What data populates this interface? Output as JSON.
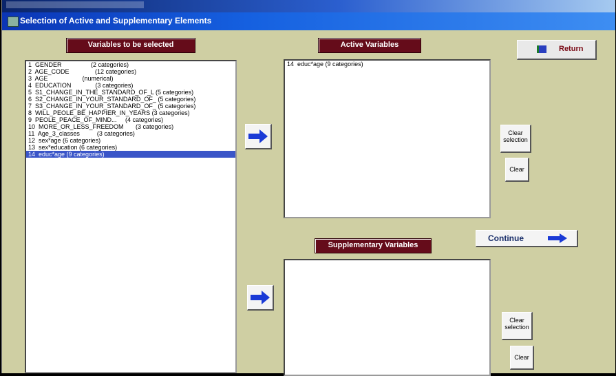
{
  "window": {
    "title": "Selection of Active and Supplementary Elements"
  },
  "headers": {
    "variables_to_select": "Variables to be selected",
    "active_variables": "Active Variables",
    "supplementary_variables": "Supplementary Variables"
  },
  "buttons": {
    "return": "Return",
    "continue": "Continue",
    "clear_selection": [
      "Clear",
      "selection"
    ],
    "clear": "Clear"
  },
  "variables": [
    "1  GENDER                 (2 categories)",
    "2  AGE_CODE               (12 categories)",
    "3  AGE                    (numerical)",
    "4  EDUCATION              (3 categories)",
    "5  S1_CHANGE_IN_THE_STANDARD_OF_L (5 categories)",
    "6  S2_CHANGE_IN_YOUR_STANDARD_OF_ (5 categories)",
    "7  S3_CHANGE_IN_YOUR_STANDARD_OF_ (5 categories)",
    "8  WILL_PEOLE_BE_HAPPIER_IN_YEARS (3 categories)",
    "9  PEOLE_PEACE_OF_MIND...     (4 categories)",
    "10  MORE_OR_LESS_FREEDOM       (3 categories)",
    "11  Age_3_classes          (3 categories)",
    "12  sex*age (6 categories)",
    "13  sex*education (6 categories)",
    "14  educ*age (9 categories)"
  ],
  "selected_variable_index": 13,
  "active_variables": [
    "14  educ*age (9 categories)"
  ],
  "supplementary_variables": [],
  "colors": {
    "background": "#cfcfa3",
    "header_bg": "#650c1a",
    "title_bar": "#1560e0",
    "selection": "#3a55c8",
    "arrow": "#1a3ad6"
  },
  "icons": {
    "window": "app-window-icon",
    "arrow": "right-arrow-icon",
    "return": "return-icon"
  }
}
